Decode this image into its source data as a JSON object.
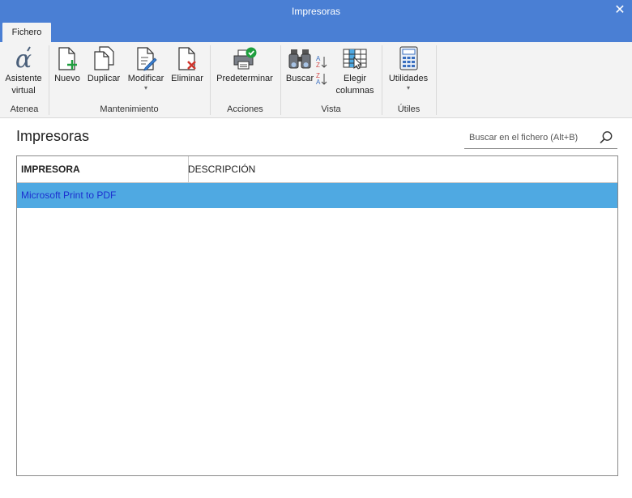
{
  "window": {
    "title": "Impresoras",
    "close_glyph": "✕"
  },
  "ribbon": {
    "tab": "Fichero",
    "groups": {
      "atenea": "Atenea",
      "mantenimiento": "Mantenimiento",
      "acciones": "Acciones",
      "vista": "Vista",
      "utiles": "Útiles"
    },
    "buttons": {
      "asistente_1": "Asistente",
      "asistente_2": "virtual",
      "nuevo": "Nuevo",
      "duplicar": "Duplicar",
      "modificar": "Modificar",
      "eliminar": "Eliminar",
      "predeterminar": "Predeterminar",
      "buscar": "Buscar",
      "elegir_1": "Elegir",
      "elegir_2": "columnas",
      "utilidades": "Utilidades"
    },
    "sort_labels": {
      "az_top": "A",
      "az_bottom": "Z",
      "za_top": "Z",
      "za_bottom": "A"
    },
    "drop_arrow": "▾"
  },
  "main": {
    "title": "Impresoras",
    "search": {
      "placeholder": "Buscar en el fichero (Alt+B)",
      "value": ""
    },
    "table": {
      "columns": [
        "IMPRESORA",
        "DESCRIPCIÓN"
      ],
      "rows": [
        {
          "impresora": "Microsoft Print to PDF",
          "descripcion": ""
        }
      ]
    }
  },
  "colors": {
    "titlebar": "#4a7fd4",
    "selected_row": "#4fa9e2",
    "selected_text": "#1c2fd0",
    "ribbon_bg": "#f3f3f3"
  },
  "icons": {
    "asistente": "alpha-icon",
    "nuevo": "new-document-icon",
    "duplicar": "duplicate-icon",
    "modificar": "edit-document-icon",
    "eliminar": "delete-document-icon",
    "predeterminar": "printer-check-icon",
    "buscar": "binoculars-icon",
    "ordenar": "sort-icon",
    "elegir_columnas": "choose-columns-icon",
    "utilidades": "calculator-icon",
    "search": "search-icon"
  }
}
